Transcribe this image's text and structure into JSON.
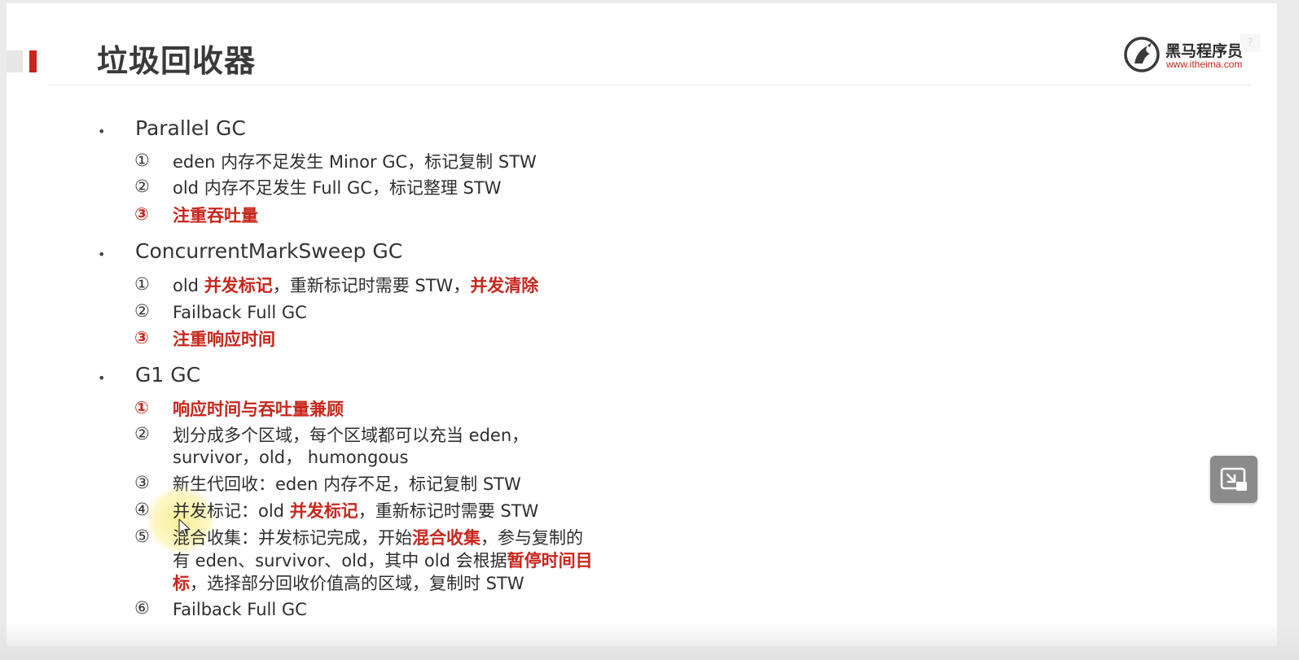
{
  "title": "垃圾回收器",
  "logo": {
    "name": "黑马程序员",
    "url": "www.itheima.com"
  },
  "help_badge": "?",
  "colors": {
    "accent_red": "#c8261c",
    "text_dark": "#2e2e2e",
    "button_gray": "#8b8b8b"
  },
  "sections": [
    {
      "title": "Parallel GC",
      "items": [
        {
          "num": "①",
          "text": "eden 内存不足发生 Minor GC，标记复制 STW"
        },
        {
          "num": "②",
          "text": "old 内存不足发生 Full GC，标记整理 STW"
        },
        {
          "num": "③",
          "text": "注重吞吐量",
          "highlight": true
        }
      ]
    },
    {
      "title": "ConcurrentMarkSweep GC",
      "items": [
        {
          "num": "①",
          "parts": [
            "old ",
            "并发标记",
            "，重新标记时需要 STW，",
            "并发清除"
          ]
        },
        {
          "num": "②",
          "text": "Failback Full GC"
        },
        {
          "num": "③",
          "text": "注重响应时间",
          "highlight": true
        }
      ]
    },
    {
      "title": "G1 GC",
      "items": [
        {
          "num": "①",
          "text": "响应时间与吞吐量兼顾",
          "highlight": true
        },
        {
          "num": "②",
          "lines": [
            "划分成多个区域，每个区域都可以充当 eden，",
            "survivor，old， humongous"
          ]
        },
        {
          "num": "③",
          "text": "新生代回收：eden 内存不足，标记复制 STW"
        },
        {
          "num": "④",
          "parts": [
            "并发标记：old ",
            "并发标记",
            "，重新标记时需要 STW"
          ]
        },
        {
          "num": "⑤",
          "line1": [
            "混合收集：并发标记完成，开始",
            "混合收集",
            "，参与复制的"
          ],
          "line2": [
            "有 eden、survivor、old，其中 old 会根据",
            "暂停时间目"
          ],
          "line3": [
            "标",
            "，选择部分回收价值高的区域，复制时 STW"
          ]
        },
        {
          "num": "⑥",
          "text": "Failback Full GC"
        }
      ]
    }
  ],
  "bullet_glyph": "•"
}
